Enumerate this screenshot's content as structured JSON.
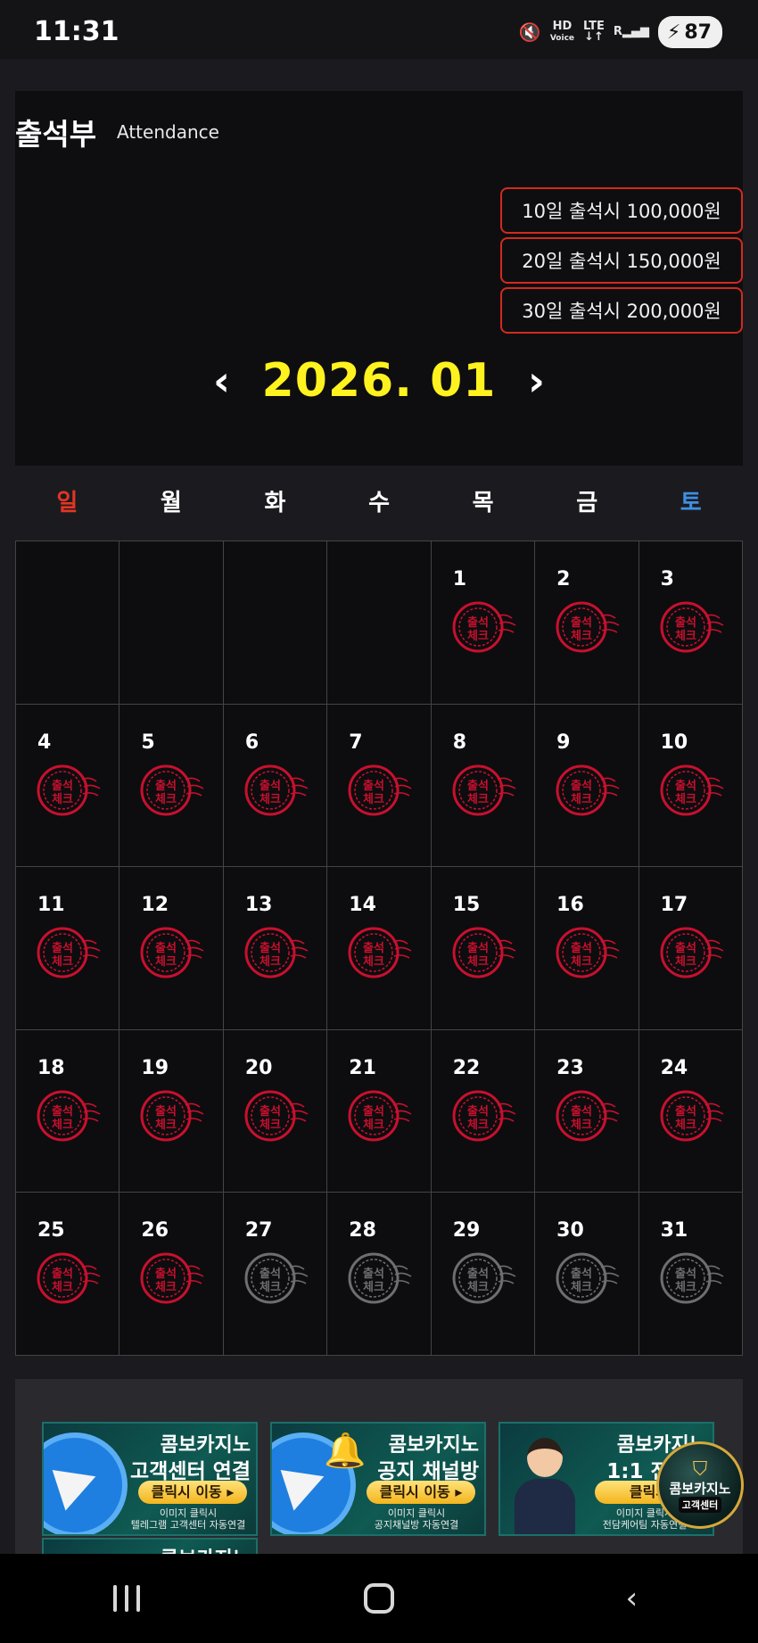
{
  "status_bar": {
    "time": "11:31",
    "hd_voice_top": "HD",
    "hd_voice_bottom": "Voice",
    "lte": "LTE",
    "roaming": "R",
    "battery": "87"
  },
  "header": {
    "title": "출석부",
    "subtitle": "Attendance"
  },
  "rewards": [
    "10일 출석시 100,000원",
    "20일 출석시 150,000원",
    "30일 출석시 200,000원"
  ],
  "month_nav": {
    "label": "2026. 01",
    "prev": "‹",
    "next": "›"
  },
  "weekdays": [
    "일",
    "월",
    "화",
    "수",
    "목",
    "금",
    "토"
  ],
  "calendar": {
    "leading_blanks": 4,
    "days_in_month": 31,
    "checked_through": 26,
    "stamp_text_top": "출석",
    "stamp_text_bottom": "체크",
    "checked_color": "#c8102e",
    "unchecked_color": "#6e6e6e"
  },
  "banners": [
    {
      "line1": "콤보카지노",
      "line2": "고객센터 연결",
      "cta": "클릭시 이동 ▸",
      "note1": "이미지 클릭시",
      "note2": "텔레그램 고객센터 자동연결"
    },
    {
      "line1": "콤보카지노",
      "line2": "공지 채널방",
      "cta": "클릭시 이동 ▸",
      "note1": "이미지 클릭시",
      "note2": "공지채널방 자동연결"
    },
    {
      "line1": "콤보카지노",
      "line2": "1:1 전담케",
      "cta": "클릭시",
      "note1": "이미지 클릭시",
      "note2": "전담케어팀 자동연결"
    },
    {
      "line1": "콤보카지노"
    }
  ],
  "floating_badge": {
    "line1": "콤보카지노",
    "line2": "고객센터"
  }
}
